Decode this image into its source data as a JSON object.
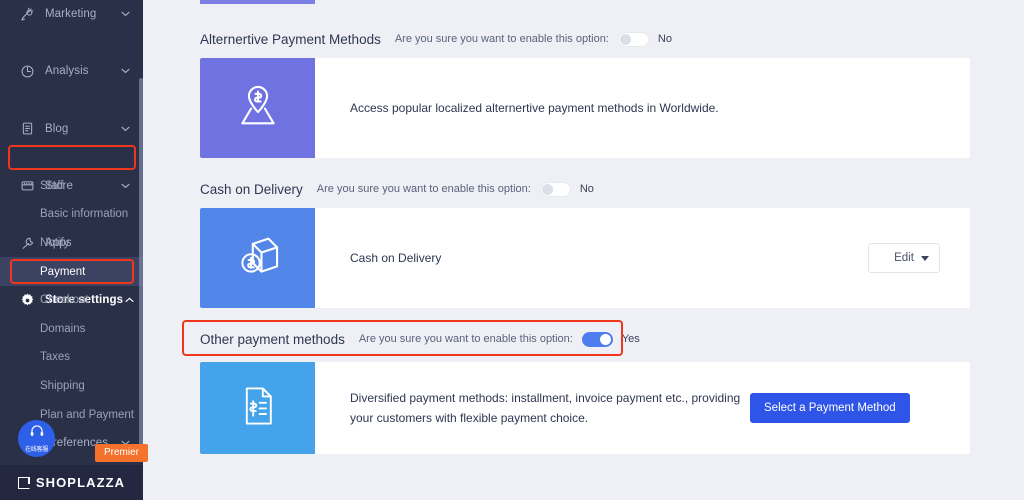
{
  "sidebar": {
    "nav": [
      {
        "label": "Marketing",
        "icon": "megaphone-icon",
        "chevron": "down"
      },
      {
        "label": "Analysis",
        "icon": "clock-pie-icon",
        "chevron": "down"
      },
      {
        "label": "Blog",
        "icon": "document-icon",
        "chevron": "down"
      },
      {
        "label": "Store",
        "icon": "store-icon",
        "chevron": "down"
      },
      {
        "label": "Apps",
        "icon": "wrench-icon",
        "chevron": ""
      },
      {
        "label": "Store settings",
        "icon": "gear-icon",
        "chevron": "up"
      }
    ],
    "sub_items": [
      {
        "label": "Staff"
      },
      {
        "label": "Basic information"
      },
      {
        "label": "Notify"
      },
      {
        "label": "Payment"
      },
      {
        "label": "Checkout"
      },
      {
        "label": "Domains"
      },
      {
        "label": "Taxes"
      },
      {
        "label": "Shipping"
      },
      {
        "label": "Plan and Payment"
      },
      {
        "label": "Preferences"
      }
    ],
    "selected_sub_item": "Payment",
    "active_nav": "Store settings",
    "brand": "SHOPLAZZA",
    "premier_badge": "Premier",
    "chat_label": "在线客服",
    "accent_annotation": "#f0361d",
    "background": "#2b3049"
  },
  "main": {
    "sections": [
      {
        "title": "Alternertive Payment Methods",
        "question": "Are you sure you want to enable this option:",
        "toggle_state": "off",
        "toggle_text": "No",
        "highlighted": false,
        "card": {
          "icon": "map-pin-dollar-icon",
          "thumb_color": "#6f72e0",
          "description": "Access popular localized alternertive payment methods in Worldwide.",
          "action": null
        }
      },
      {
        "title": "Cash on Delivery",
        "question": "Are you sure you want to enable this option:",
        "toggle_state": "off",
        "toggle_text": "No",
        "highlighted": false,
        "card": {
          "icon": "box-dollar-icon",
          "thumb_color": "#5286e8",
          "description": "Cash on Delivery",
          "action": {
            "type": "dropdown-button",
            "label": "Edit"
          }
        }
      },
      {
        "title": "Other payment methods",
        "question": "Are you sure you want to enable this option:",
        "toggle_state": "on",
        "toggle_text": "Yes",
        "highlighted": true,
        "card": {
          "icon": "invoice-dollar-icon",
          "thumb_color": "#44a3ea",
          "description": "Diversified payment methods: installment, invoice payment etc., providing your customers with flexible payment choice.",
          "action": {
            "type": "primary-button",
            "label": "Select a Payment Method"
          }
        }
      }
    ],
    "background": "#eef0f5",
    "primary_color": "#2e55e8"
  }
}
